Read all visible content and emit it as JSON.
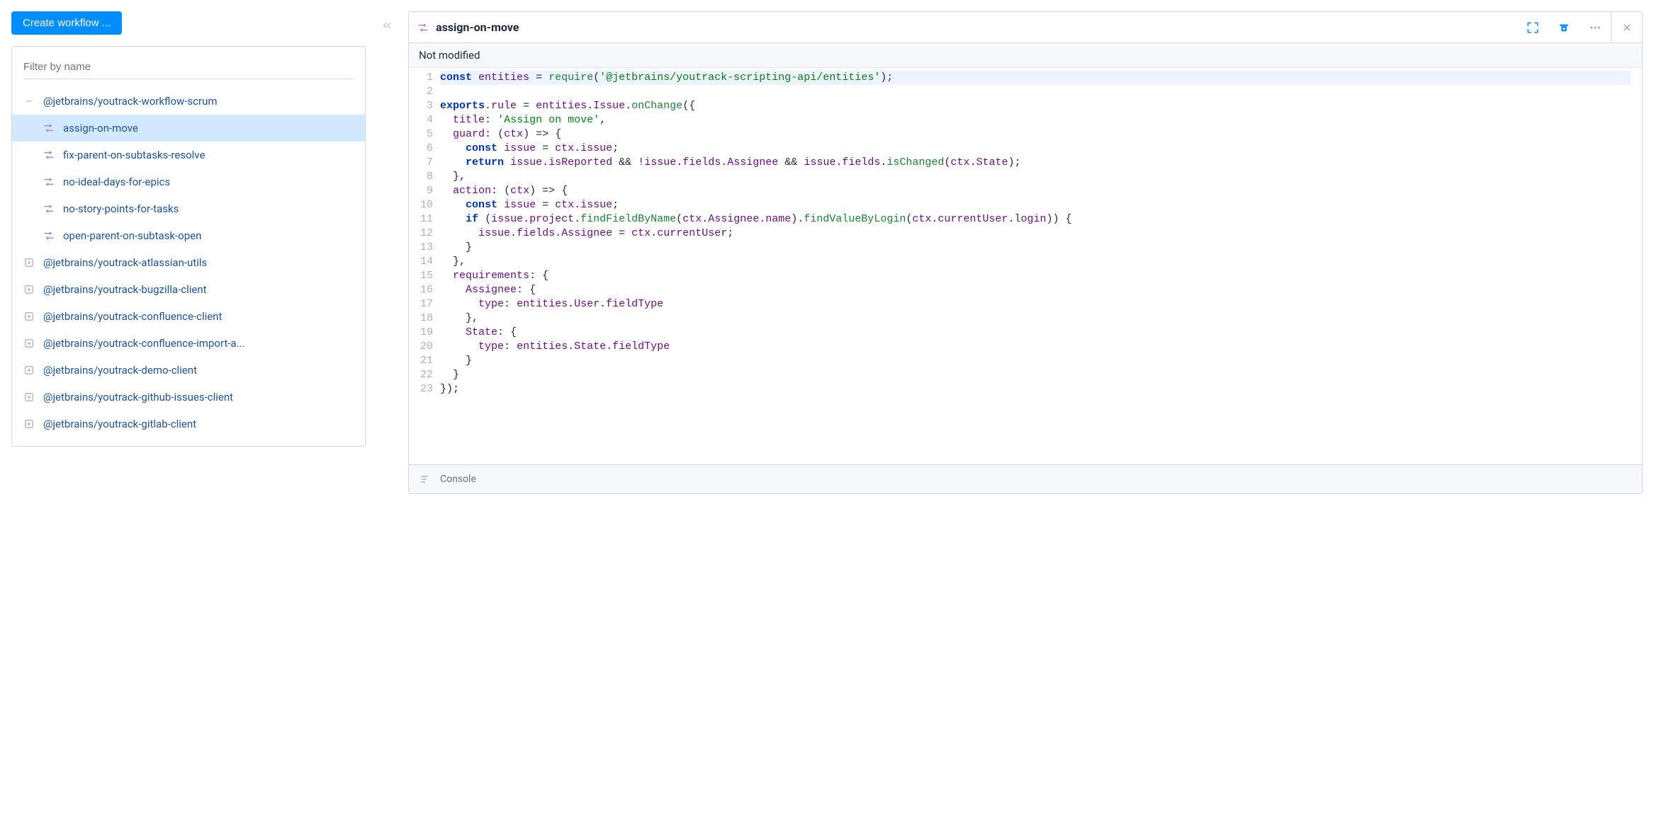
{
  "toolbar": {
    "createButton": "Create workflow ..."
  },
  "filter": {
    "placeholder": "Filter by name"
  },
  "tree": {
    "expanded": {
      "name": "@jetbrains/youtrack-workflow-scrum",
      "children": [
        "assign-on-move",
        "fix-parent-on-subtasks-resolve",
        "no-ideal-days-for-epics",
        "no-story-points-for-tasks",
        "open-parent-on-subtask-open"
      ],
      "selectedIndex": 0
    },
    "collapsed": [
      "@jetbrains/youtrack-atlassian-utils",
      "@jetbrains/youtrack-bugzilla-client",
      "@jetbrains/youtrack-confluence-client",
      "@jetbrains/youtrack-confluence-import-a...",
      "@jetbrains/youtrack-demo-client",
      "@jetbrains/youtrack-github-issues-client",
      "@jetbrains/youtrack-gitlab-client"
    ]
  },
  "editor": {
    "title": "assign-on-move",
    "status": "Not modified",
    "console": "Console",
    "code": [
      "const entities = require('@jetbrains/youtrack-scripting-api/entities');",
      "",
      "exports.rule = entities.Issue.onChange({",
      "  title: 'Assign on move',",
      "  guard: (ctx) => {",
      "    const issue = ctx.issue;",
      "    return issue.isReported && !issue.fields.Assignee && issue.fields.isChanged(ctx.State);",
      "  },",
      "  action: (ctx) => {",
      "    const issue = ctx.issue;",
      "    if (issue.project.findFieldByName(ctx.Assignee.name).findValueByLogin(ctx.currentUser.login)) {",
      "      issue.fields.Assignee = ctx.currentUser;",
      "    }",
      "  },",
      "  requirements: {",
      "    Assignee: {",
      "      type: entities.User.fieldType",
      "    },",
      "    State: {",
      "      type: entities.State.fieldType",
      "    }",
      "  }",
      "});"
    ]
  }
}
